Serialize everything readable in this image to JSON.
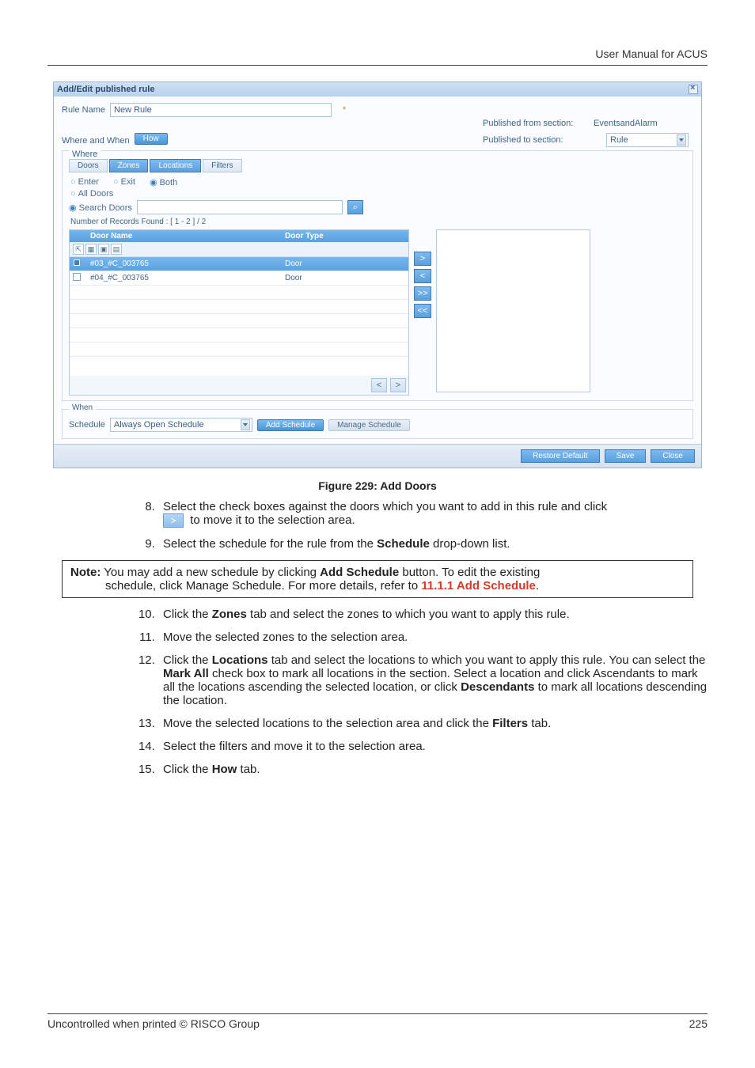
{
  "header": {
    "title": "User Manual for ACUS"
  },
  "dialog": {
    "title": "Add/Edit published rule",
    "rule_name_label": "Rule Name",
    "rule_name_value": "New Rule",
    "published_from_label": "Published from section:",
    "published_from_value": "EventsandAlarm",
    "published_to_label": "Published to section:",
    "published_to_value": "Rule",
    "where_when_label": "Where and When",
    "how_btn": "How",
    "where_label": "Where",
    "tabs": {
      "doors": "Doors",
      "zones": "Zones",
      "locations": "Locations",
      "filters": "Filters"
    },
    "radios": {
      "enter": "Enter",
      "exit": "Exit",
      "both": "Both"
    },
    "all_doors_radio": "All Doors",
    "search_radio": "Search Doors",
    "records_found": "Number of Records Found :  [ 1 - 2 ] / 2",
    "grid_headers": {
      "name": "Door Name",
      "type": "Door Type"
    },
    "rows": [
      {
        "name": "#03_#C_003765",
        "type": "Door",
        "checked": true
      },
      {
        "name": "#04_#C_003765",
        "type": "Door",
        "checked": false
      }
    ],
    "arrows": {
      "add": ">",
      "remove": "<",
      "add_all": ">>",
      "remove_all": "<<"
    },
    "pager": {
      "prev": "<",
      "next": ">"
    },
    "when_legend": "When",
    "schedule_label": "Schedule",
    "schedule_value": "Always Open Schedule",
    "add_schedule_btn": "Add Schedule",
    "manage_schedule_btn": "Manage Schedule",
    "footer": {
      "restore": "Restore Default",
      "save": "Save",
      "close": "Close"
    }
  },
  "caption": "Figure 229: Add Doors",
  "steps_first": [
    {
      "num": "8.",
      "text_a": "Select the check boxes against the doors which you want to add in this rule and click",
      "text_b": " to move it to the selection area."
    },
    {
      "num": "9.",
      "text_a": "Select the schedule for the rule from the ",
      "bold": "Schedule",
      "text_b": " drop-down list."
    }
  ],
  "note": {
    "lead": "Note:",
    "line1a": " You may add a new schedule by clicking ",
    "line1b": "Add Schedule",
    "line1c": " button. To edit the existing",
    "line2a": "schedule, click Manage Schedule. For more details, refer to ",
    "link": "11.1.1 Add Schedule",
    "line2b": "."
  },
  "steps_cont": [
    {
      "num": "10.",
      "parts": [
        {
          "t": "Click the "
        },
        {
          "b": "Zones"
        },
        {
          "t": " tab and select the zones to which you want to apply this rule."
        }
      ]
    },
    {
      "num": "11.",
      "parts": [
        {
          "t": "Move the selected zones to the selection area."
        }
      ]
    },
    {
      "num": "12.",
      "parts": [
        {
          "t": "Click the "
        },
        {
          "b": "Locations"
        },
        {
          "t": " tab and select the locations to which you want to apply this rule. You can select the "
        },
        {
          "b": "Mark All"
        },
        {
          "t": " check box to mark all locations in the section. Select a location and click Ascendants to mark all the locations ascending the selected location, or click "
        },
        {
          "b": "Descendants"
        },
        {
          "t": " to mark all locations descending the location."
        }
      ]
    },
    {
      "num": "13.",
      "parts": [
        {
          "t": "Move the selected locations to the selection area and click the "
        },
        {
          "b": "Filters"
        },
        {
          "t": " tab."
        }
      ]
    },
    {
      "num": "14.",
      "parts": [
        {
          "t": "Select the filters and move it to the selection area."
        }
      ]
    },
    {
      "num": "15.",
      "parts": [
        {
          "t": "Click the "
        },
        {
          "b": "How"
        },
        {
          "t": " tab."
        }
      ]
    }
  ],
  "footer": {
    "left": "Uncontrolled when printed © RISCO Group",
    "right": "225"
  }
}
